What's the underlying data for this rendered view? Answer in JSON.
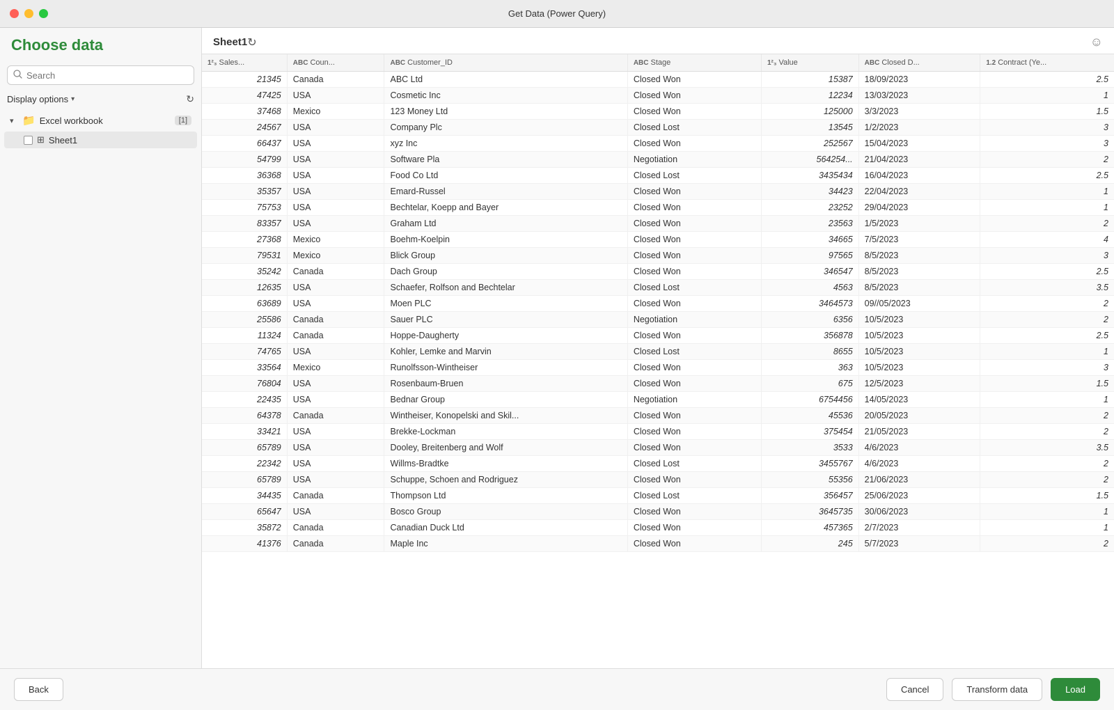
{
  "titleBar": {
    "title": "Get Data (Power Query)"
  },
  "sidebar": {
    "heading": "Choose data",
    "search": {
      "placeholder": "Search",
      "value": ""
    },
    "displayOptions": "Display options",
    "refreshTitle": "Refresh",
    "workbook": {
      "name": "Excel workbook",
      "count": "[1]",
      "sheets": [
        {
          "name": "Sheet1",
          "selected": false
        }
      ]
    }
  },
  "main": {
    "sheetTitle": "Sheet1",
    "columns": [
      {
        "type": "1²₃",
        "label": "Sales..."
      },
      {
        "type": "ABC",
        "label": "Coun..."
      },
      {
        "type": "ABC",
        "label": "Customer_ID"
      },
      {
        "type": "ABC",
        "label": "Stage"
      },
      {
        "type": "1²₃",
        "label": "Value"
      },
      {
        "type": "ABC",
        "label": "Closed D..."
      },
      {
        "type": "1.2",
        "label": "Contract (Ye..."
      }
    ],
    "rows": [
      {
        "sales": "21345",
        "country": "Canada",
        "customer": "ABC Ltd",
        "stage": "Closed Won",
        "value": "15387",
        "closed": "18/09/2023",
        "contract": "2.5"
      },
      {
        "sales": "47425",
        "country": "USA",
        "customer": "Cosmetic Inc",
        "stage": "Closed Won",
        "value": "12234",
        "closed": "13/03/2023",
        "contract": "1"
      },
      {
        "sales": "37468",
        "country": "Mexico",
        "customer": "123 Money Ltd",
        "stage": "Closed Won",
        "value": "125000",
        "closed": "3/3/2023",
        "contract": "1.5"
      },
      {
        "sales": "24567",
        "country": "USA",
        "customer": "Company Plc",
        "stage": "Closed Lost",
        "value": "13545",
        "closed": "1/2/2023",
        "contract": "3"
      },
      {
        "sales": "66437",
        "country": "USA",
        "customer": "xyz Inc",
        "stage": "Closed Won",
        "value": "252567",
        "closed": "15/04/2023",
        "contract": "3"
      },
      {
        "sales": "54799",
        "country": "USA",
        "customer": "Software Pla",
        "stage": "Negotiation",
        "value": "564254...",
        "closed": "21/04/2023",
        "contract": "2"
      },
      {
        "sales": "36368",
        "country": "USA",
        "customer": "Food Co Ltd",
        "stage": "Closed Lost",
        "value": "3435434",
        "closed": "16/04/2023",
        "contract": "2.5"
      },
      {
        "sales": "35357",
        "country": "USA",
        "customer": "Emard-Russel",
        "stage": "Closed Won",
        "value": "34423",
        "closed": "22/04/2023",
        "contract": "1"
      },
      {
        "sales": "75753",
        "country": "USA",
        "customer": "Bechtelar, Koepp and Bayer",
        "stage": "Closed Won",
        "value": "23252",
        "closed": "29/04/2023",
        "contract": "1"
      },
      {
        "sales": "83357",
        "country": "USA",
        "customer": "Graham Ltd",
        "stage": "Closed Won",
        "value": "23563",
        "closed": "1/5/2023",
        "contract": "2"
      },
      {
        "sales": "27368",
        "country": "Mexico",
        "customer": "Boehm-Koelpin",
        "stage": "Closed Won",
        "value": "34665",
        "closed": "7/5/2023",
        "contract": "4"
      },
      {
        "sales": "79531",
        "country": "Mexico",
        "customer": "Blick Group",
        "stage": "Closed Won",
        "value": "97565",
        "closed": "8/5/2023",
        "contract": "3"
      },
      {
        "sales": "35242",
        "country": "Canada",
        "customer": "Dach Group",
        "stage": "Closed Won",
        "value": "346547",
        "closed": "8/5/2023",
        "contract": "2.5"
      },
      {
        "sales": "12635",
        "country": "USA",
        "customer": "Schaefer, Rolfson and Bechtelar",
        "stage": "Closed Lost",
        "value": "4563",
        "closed": "8/5/2023",
        "contract": "3.5"
      },
      {
        "sales": "63689",
        "country": "USA",
        "customer": "Moen PLC",
        "stage": "Closed Won",
        "value": "3464573",
        "closed": "09//05/2023",
        "contract": "2"
      },
      {
        "sales": "25586",
        "country": "Canada",
        "customer": "Sauer PLC",
        "stage": "Negotiation",
        "value": "6356",
        "closed": "10/5/2023",
        "contract": "2"
      },
      {
        "sales": "11324",
        "country": "Canada",
        "customer": "Hoppe-Daugherty",
        "stage": "Closed Won",
        "value": "356878",
        "closed": "10/5/2023",
        "contract": "2.5"
      },
      {
        "sales": "74765",
        "country": "USA",
        "customer": "Kohler, Lemke and Marvin",
        "stage": "Closed Lost",
        "value": "8655",
        "closed": "10/5/2023",
        "contract": "1"
      },
      {
        "sales": "33564",
        "country": "Mexico",
        "customer": "Runolfsson-Wintheiser",
        "stage": "Closed Won",
        "value": "363",
        "closed": "10/5/2023",
        "contract": "3"
      },
      {
        "sales": "76804",
        "country": "USA",
        "customer": "Rosenbaum-Bruen",
        "stage": "Closed Won",
        "value": "675",
        "closed": "12/5/2023",
        "contract": "1.5"
      },
      {
        "sales": "22435",
        "country": "USA",
        "customer": "Bednar Group",
        "stage": "Negotiation",
        "value": "6754456",
        "closed": "14/05/2023",
        "contract": "1"
      },
      {
        "sales": "64378",
        "country": "Canada",
        "customer": "Wintheiser, Konopelski and Skil...",
        "stage": "Closed Won",
        "value": "45536",
        "closed": "20/05/2023",
        "contract": "2"
      },
      {
        "sales": "33421",
        "country": "USA",
        "customer": "Brekke-Lockman",
        "stage": "Closed Won",
        "value": "375454",
        "closed": "21/05/2023",
        "contract": "2"
      },
      {
        "sales": "65789",
        "country": "USA",
        "customer": "Dooley, Breitenberg and Wolf",
        "stage": "Closed Won",
        "value": "3533",
        "closed": "4/6/2023",
        "contract": "3.5"
      },
      {
        "sales": "22342",
        "country": "USA",
        "customer": "Willms-Bradtke",
        "stage": "Closed Lost",
        "value": "3455767",
        "closed": "4/6/2023",
        "contract": "2"
      },
      {
        "sales": "65789",
        "country": "USA",
        "customer": "Schuppe, Schoen and Rodriguez",
        "stage": "Closed Won",
        "value": "55356",
        "closed": "21/06/2023",
        "contract": "2"
      },
      {
        "sales": "34435",
        "country": "Canada",
        "customer": "Thompson Ltd",
        "stage": "Closed Lost",
        "value": "356457",
        "closed": "25/06/2023",
        "contract": "1.5"
      },
      {
        "sales": "65647",
        "country": "USA",
        "customer": "Bosco Group",
        "stage": "Closed Won",
        "value": "3645735",
        "closed": "30/06/2023",
        "contract": "1"
      },
      {
        "sales": "35872",
        "country": "Canada",
        "customer": "Canadian Duck Ltd",
        "stage": "Closed Won",
        "value": "457365",
        "closed": "2/7/2023",
        "contract": "1"
      },
      {
        "sales": "41376",
        "country": "Canada",
        "customer": "Maple Inc",
        "stage": "Closed Won",
        "value": "245",
        "closed": "5/7/2023",
        "contract": "2"
      }
    ]
  },
  "footer": {
    "back": "Back",
    "cancel": "Cancel",
    "transform": "Transform data",
    "load": "Load"
  },
  "topRight": {
    "emoji": "☺"
  }
}
